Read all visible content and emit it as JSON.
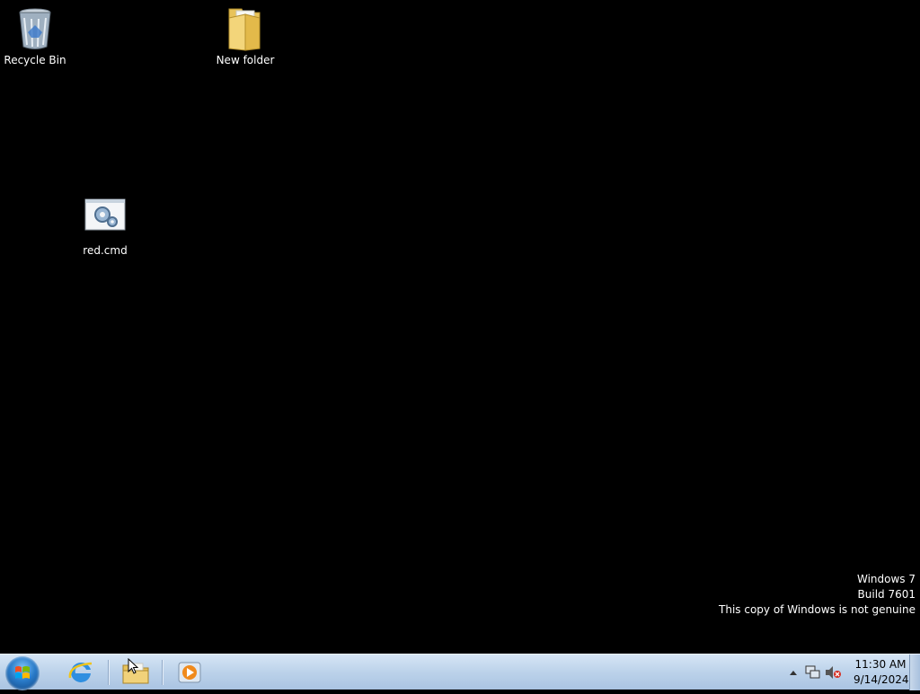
{
  "desktop": {
    "icons": [
      {
        "label": "Recycle Bin",
        "icon": "recycle-bin-icon"
      },
      {
        "label": "New folder",
        "icon": "folder-icon"
      },
      {
        "label": "red.cmd",
        "icon": "cmd-script-icon"
      }
    ],
    "watermark": {
      "line1": "Windows 7",
      "line2": "Build 7601",
      "line3": "This copy of Windows is not genuine"
    }
  },
  "taskbar": {
    "start_icon": "windows-logo-icon",
    "pinned": [
      {
        "name": "Internet Explorer",
        "icon": "internet-explorer-icon"
      },
      {
        "name": "Windows Explorer",
        "icon": "file-explorer-icon"
      },
      {
        "name": "Windows Media Player",
        "icon": "media-player-icon"
      }
    ],
    "tray": {
      "icons": [
        "show-hidden-icons-arrow",
        "network-icon",
        "volume-muted-icon"
      ]
    },
    "clock": {
      "time": "11:30 AM",
      "date": "9/14/2024"
    }
  },
  "colors": {
    "desktop_background": "#000000",
    "taskbar_top": "#d6e5f5",
    "taskbar_bottom": "#aac4e2"
  }
}
